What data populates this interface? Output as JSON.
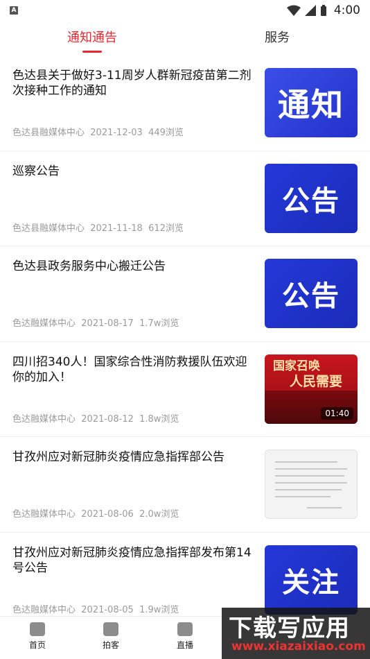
{
  "status_bar": {
    "time": "4:00",
    "left_glyph": "A"
  },
  "tabs": [
    {
      "label": "通知通告",
      "active": true
    },
    {
      "label": "服务",
      "active": false
    }
  ],
  "accent_color": "#e8262e",
  "items": [
    {
      "title": "色达县关于做好3-11周岁人群新冠疫苗第二剂次接种工作的通知",
      "source": "色达县融媒体中心",
      "date": "2021-12-03",
      "views": "449浏览",
      "thumb_text": "通知"
    },
    {
      "title": "巡察公告",
      "source": "色达县融媒体中心",
      "date": "2021-11-18",
      "views": "612浏览",
      "thumb_text": "公告"
    },
    {
      "title": "色达县政务服务中心搬迁公告",
      "source": "色达融媒体中心",
      "date": "2021-08-17",
      "views": "1.7w浏览",
      "thumb_text": "公告"
    },
    {
      "title": "四川招340人！国家综合性消防救援队伍欢迎你的加入！",
      "source": "色达融媒体中心",
      "date": "2021-08-12",
      "views": "1.8w浏览",
      "thumb_line1": "国家召唤",
      "thumb_line2": "人民需要",
      "duration": "01:40"
    },
    {
      "title": "甘孜州应对新冠肺炎疫情应急指挥部公告",
      "source": "色达融媒体中心",
      "date": "2021-08-06",
      "views": "2.0w浏览",
      "thumb_kind": "document"
    },
    {
      "title": "甘孜州应对新冠肺炎疫情应急指挥部发布第14号公告",
      "source": "色达融媒体中心",
      "date": "2021-08-05",
      "views": "1.9w浏览",
      "thumb_text": "关注"
    }
  ],
  "bottom_nav": [
    {
      "label": "首页",
      "icon": "home-icon"
    },
    {
      "label": "拍客",
      "icon": "camera-icon"
    },
    {
      "label": "直播",
      "icon": "video-icon"
    }
  ],
  "watermark": {
    "line1": "下载写应用",
    "line2": "www.xiazaixiao.com"
  }
}
